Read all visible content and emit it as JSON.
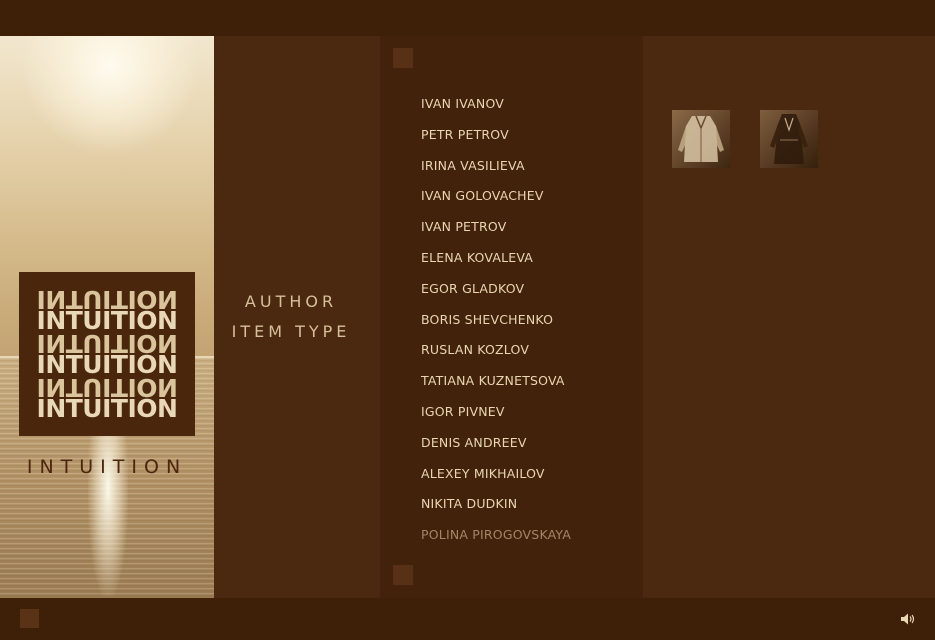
{
  "brand": {
    "logo_rows": [
      "INTUITION",
      "INTUITION",
      "INTUITION",
      "INTUITION"
    ],
    "name": "INTUITION"
  },
  "filters": [
    {
      "label": "AUTHOR"
    },
    {
      "label": "ITEM TYPE"
    }
  ],
  "authors": [
    "IVAN IVANOV",
    "PETR PETROV",
    "IRINA VASILIEVA",
    "IVAN GOLOVACHEV",
    "IVAN PETROV",
    "ELENA KOVALEVA",
    "EGOR GLADKOV",
    "BORIS SHEVCHENKO",
    "RUSLAN KOZLOV",
    "TATIANA KUZNETSOVA",
    "IGOR PIVNEV",
    "DENIS ANDREEV",
    "ALEXEY MIKHAILOV",
    "NIKITA DUDKIN",
    "POLINA PIROGOVSKAYA"
  ],
  "icons": {
    "sound": "speaker-icon"
  }
}
